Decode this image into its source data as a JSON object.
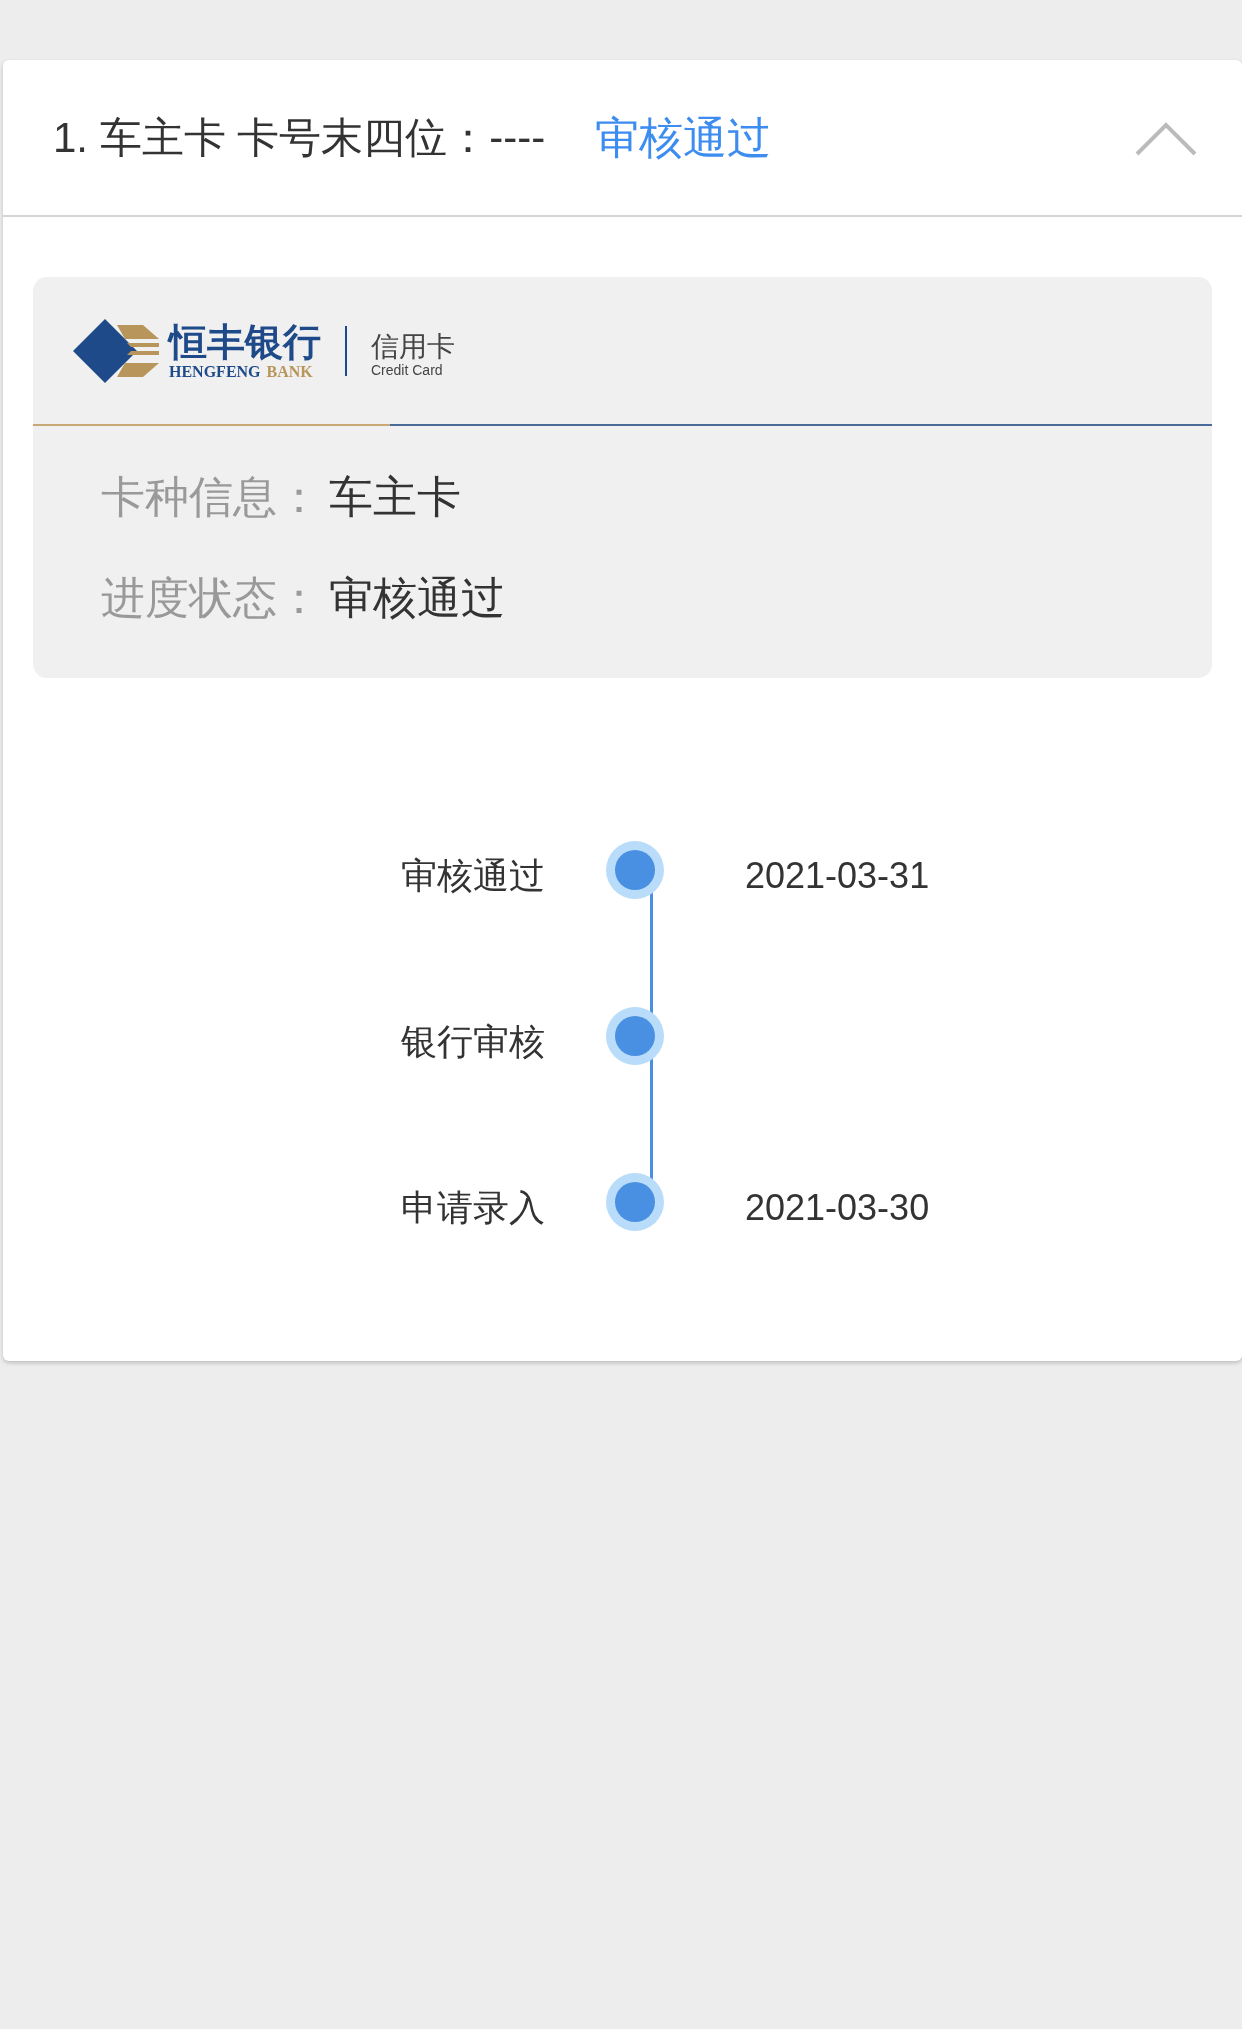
{
  "application": {
    "title": "1. 车主卡 卡号末四位：----",
    "status": "审核通过",
    "expanded": true,
    "bank": {
      "name_cn": "恒丰银行",
      "name_en_1": "HENGFENG",
      "name_en_2": "BANK",
      "product_cn": "信用卡",
      "product_en": "Credit Card"
    },
    "fields": [
      {
        "label": "卡种信息：",
        "value": "车主卡"
      },
      {
        "label": "进度状态：",
        "value": "审核通过"
      }
    ],
    "steps": [
      {
        "label": "审核通过",
        "date": "2021-03-31"
      },
      {
        "label": "银行审核"
      },
      {
        "label": "申请录入",
        "date": "2021-03-30"
      }
    ]
  }
}
